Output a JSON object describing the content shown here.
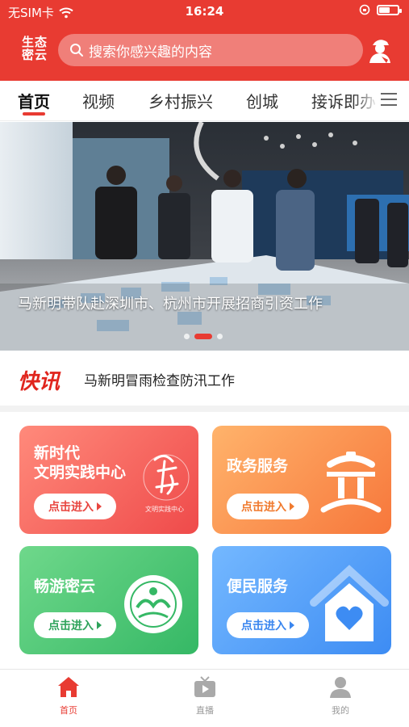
{
  "status_bar": {
    "carrier": "无SIM卡",
    "time": "16:24"
  },
  "header": {
    "logo_line1": "生态",
    "logo_line2": "密云",
    "search_placeholder": "搜索你感兴趣的内容",
    "accent_color": "#e83b32"
  },
  "tabs": [
    "首页",
    "视频",
    "乡村振兴",
    "创城",
    "接诉即办"
  ],
  "banner": {
    "caption": "马新明带队赴深圳市、杭州市开展招商引资工作",
    "active_slide": 2,
    "slide_count": 3
  },
  "news": {
    "label": "快讯",
    "headline": "马新明冒雨检查防汛工作"
  },
  "cards": [
    {
      "title_line1": "新时代",
      "title_line2": "文明实践中心",
      "enter": "点击进入",
      "icon": "civilization-practice-icon",
      "icon_caption": "文明实践中心"
    },
    {
      "title_line1": "政务服务",
      "title_line2": "",
      "enter": "点击进入",
      "icon": "gov-building-icon"
    },
    {
      "title_line1": "畅游密云",
      "title_line2": "",
      "enter": "点击进入",
      "icon": "scenic-seal-icon"
    },
    {
      "title_line1": "便民服务",
      "title_line2": "",
      "enter": "点击进入",
      "icon": "heart-house-icon"
    }
  ],
  "bottom_nav": [
    {
      "label": "首页",
      "icon": "home-icon",
      "active": true
    },
    {
      "label": "直播",
      "icon": "tv-icon",
      "active": false
    },
    {
      "label": "我的",
      "icon": "profile-icon",
      "active": false
    }
  ]
}
